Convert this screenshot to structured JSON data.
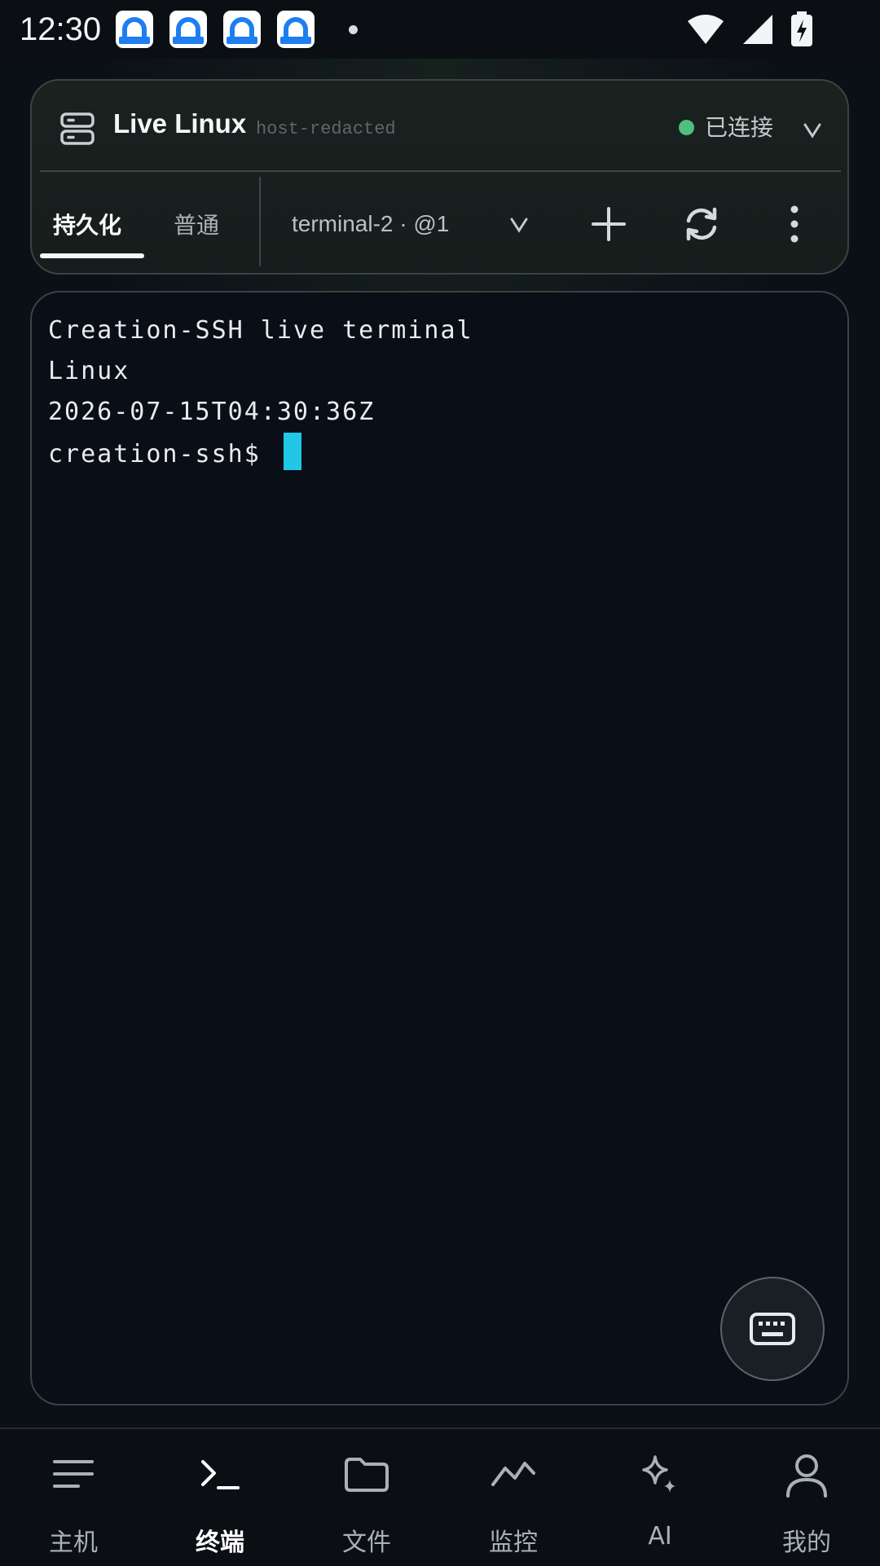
{
  "status_bar": {
    "time": "12:30",
    "notification_icons": [
      "app-notification-icon",
      "app-notification-icon",
      "app-notification-icon",
      "app-notification-icon"
    ],
    "indicators": [
      "wifi-icon",
      "signal-icon",
      "battery-charging-icon"
    ]
  },
  "header": {
    "host_name": "Live Linux",
    "host_address": "host-redacted",
    "connection_status": "已连接",
    "status_color": "#4ec07c"
  },
  "tabs": {
    "persistent_label": "持久化",
    "normal_label": "普通",
    "active": "persistent",
    "session_name": "terminal-2 · @1"
  },
  "terminal": {
    "lines": [
      "Creation-SSH live terminal",
      "Linux",
      "2026-07-15T04:30:36Z"
    ],
    "prompt": "creation-ssh$ ",
    "cursor_color": "#22c7e6"
  },
  "bottom_nav": {
    "items": [
      {
        "label": "主机",
        "icon": "menu-lines-icon"
      },
      {
        "label": "终端",
        "icon": "terminal-prompt-icon"
      },
      {
        "label": "文件",
        "icon": "folder-icon"
      },
      {
        "label": "监控",
        "icon": "chart-line-icon"
      },
      {
        "label": "AI",
        "icon": "sparkle-icon"
      },
      {
        "label": "我的",
        "icon": "user-icon"
      }
    ],
    "active_index": 1
  }
}
